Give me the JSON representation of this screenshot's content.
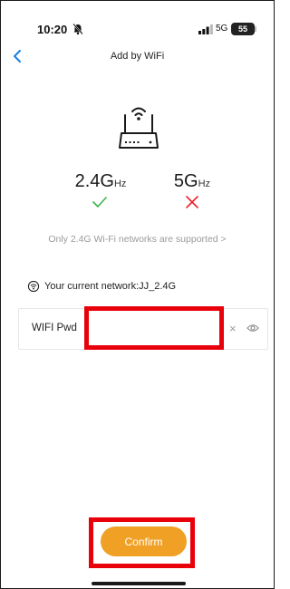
{
  "status_bar": {
    "time": "10:20",
    "network": "5G",
    "battery": "55"
  },
  "header": {
    "title": "Add by WiFi"
  },
  "bands": {
    "band_24": {
      "number": "2.4G",
      "unit": "Hz",
      "supported": true
    },
    "band_5": {
      "number": "5G",
      "unit": "Hz",
      "supported": false
    }
  },
  "note": "Only 2.4G Wi-Fi networks are supported >",
  "current_network": "Your current network:JJ_2.4G",
  "password": {
    "label": "WIFI Pwd",
    "value": "",
    "placeholder": ""
  },
  "confirm_label": "Confirm",
  "colors": {
    "accent": "#f0a025",
    "check": "#3ab54a",
    "cross": "#e8222b",
    "highlight": "#e8000b",
    "back_arrow": "#1a7fe0"
  }
}
